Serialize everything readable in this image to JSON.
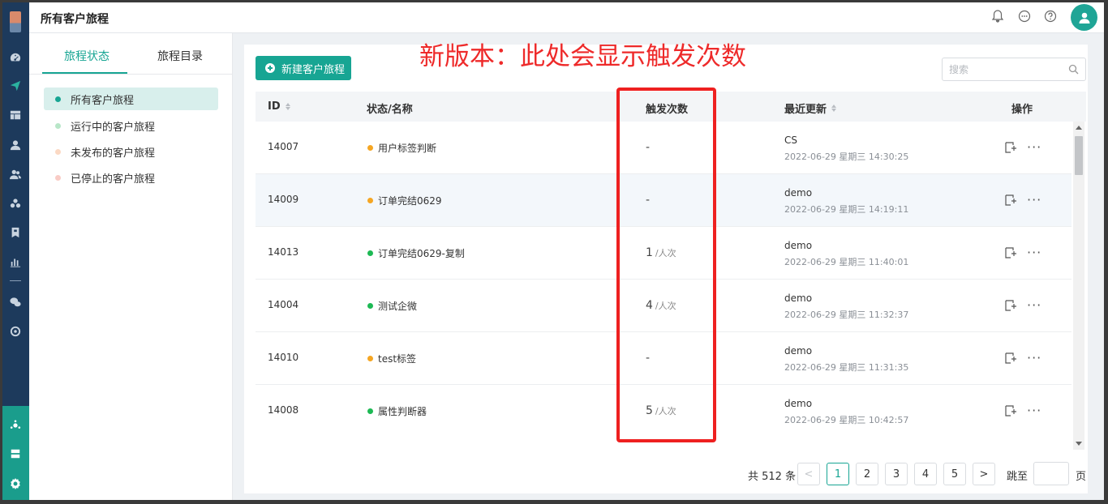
{
  "header": {
    "title": "所有客户旅程"
  },
  "left_panel": {
    "tabs": [
      {
        "label": "旅程状态",
        "active": true
      },
      {
        "label": "旅程目录",
        "active": false
      }
    ],
    "status_items": [
      {
        "label": "所有客户旅程",
        "dot_color": "#17a593",
        "active": true
      },
      {
        "label": "运行中的客户旅程",
        "dot_color": "#b8e6c8",
        "active": false
      },
      {
        "label": "未发布的客户旅程",
        "dot_color": "#fbd9c4",
        "active": false
      },
      {
        "label": "已停止的客户旅程",
        "dot_color": "#f9ccc6",
        "active": false
      }
    ]
  },
  "toolbar": {
    "new_button_label": "新建客户旅程",
    "search_placeholder": "搜索"
  },
  "annotation": "新版本：此处会显示触发次数",
  "table": {
    "columns": [
      "ID",
      "状态/名称",
      "触发次数",
      "最近更新",
      "操作"
    ],
    "rows": [
      {
        "id": "14007",
        "name": "用户标签判断",
        "status_color": "#f5a623",
        "count": "-",
        "count_unit": "",
        "user": "CS",
        "time": "2022-06-29 星期三 14:30:25"
      },
      {
        "id": "14009",
        "name": "订单完结0629",
        "status_color": "#f5a623",
        "count": "-",
        "count_unit": "",
        "user": "demo",
        "time": "2022-06-29 星期三 14:19:11"
      },
      {
        "id": "14013",
        "name": "订单完结0629-复制",
        "status_color": "#1db954",
        "count": "1",
        "count_unit": "/人次",
        "user": "demo",
        "time": "2022-06-29 星期三 11:40:01"
      },
      {
        "id": "14004",
        "name": "测试企微",
        "status_color": "#1db954",
        "count": "4",
        "count_unit": "/人次",
        "user": "demo",
        "time": "2022-06-29 星期三 11:32:37"
      },
      {
        "id": "14010",
        "name": "test标签",
        "status_color": "#f5a623",
        "count": "-",
        "count_unit": "",
        "user": "demo",
        "time": "2022-06-29 星期三 11:31:35"
      },
      {
        "id": "14008",
        "name": "属性判断器",
        "status_color": "#1db954",
        "count": "5",
        "count_unit": "/人次",
        "user": "demo",
        "time": "2022-06-29 星期三 10:42:57"
      }
    ]
  },
  "pagination": {
    "total_text": "共 512 条",
    "prev": "<",
    "pages": [
      "1",
      "2",
      "3",
      "4",
      "5"
    ],
    "current": "1",
    "next": ">",
    "jump_label": "跳至",
    "page_suffix": "页"
  },
  "colors": {
    "accent": "#17a593",
    "nav_bg": "#1d3a5c",
    "annotation_red": "#ee2a2a"
  }
}
